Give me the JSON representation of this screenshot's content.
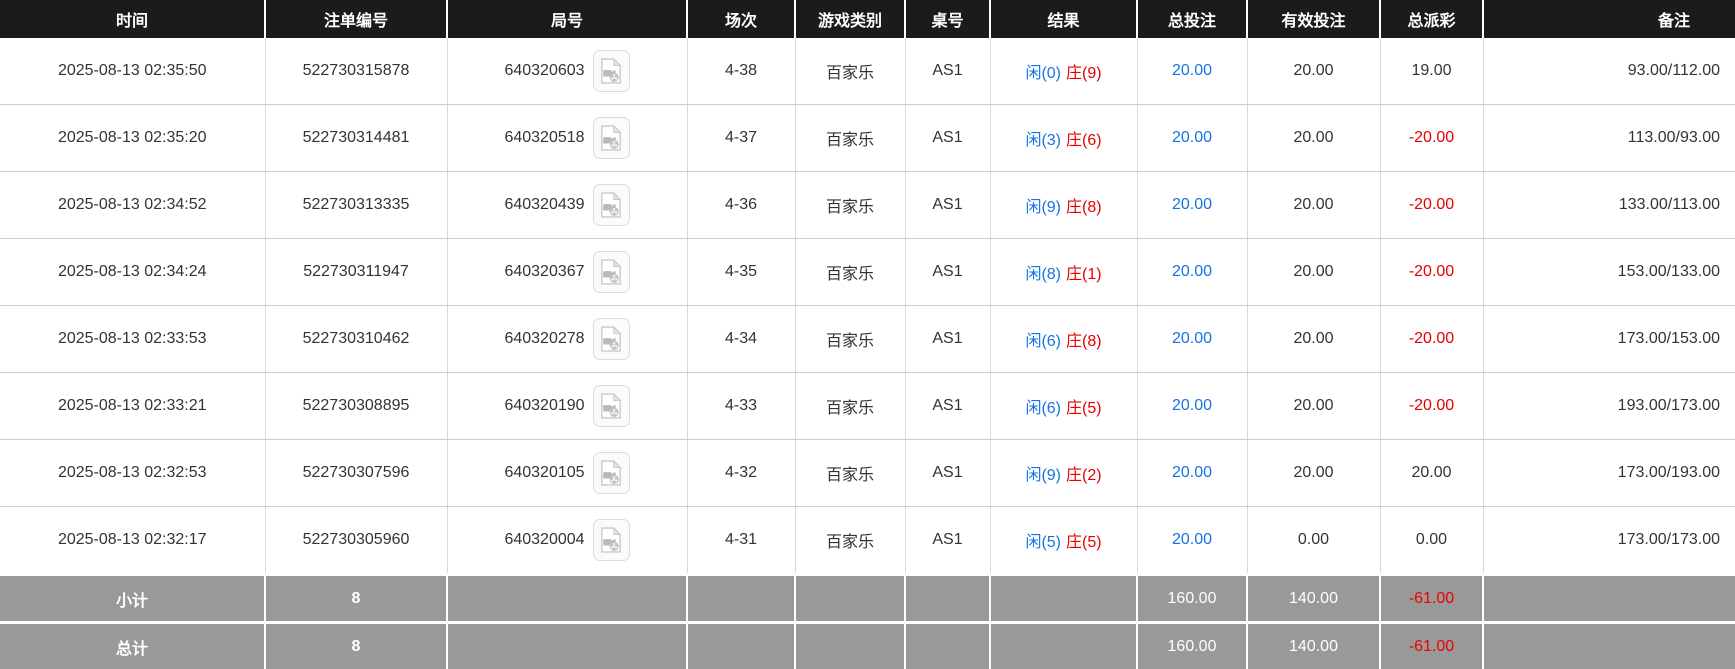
{
  "table": {
    "columns": [
      {
        "key": "time",
        "label": "时间"
      },
      {
        "key": "bet_no",
        "label": "注单编号"
      },
      {
        "key": "game_no",
        "label": "局号"
      },
      {
        "key": "session",
        "label": "场次"
      },
      {
        "key": "game_type",
        "label": "游戏类别"
      },
      {
        "key": "table_no",
        "label": "桌号"
      },
      {
        "key": "result",
        "label": "结果"
      },
      {
        "key": "total_bet",
        "label": "总投注"
      },
      {
        "key": "valid_bet",
        "label": "有效投注"
      },
      {
        "key": "payout",
        "label": "总派彩"
      },
      {
        "key": "remark",
        "label": "备注"
      }
    ],
    "rows": [
      {
        "time": "2025-08-13 02:35:50",
        "bet_no": "522730315878",
        "game_no": "640320603",
        "session": "4-38",
        "game_type": "百家乐",
        "table_no": "AS1",
        "result_player": "闲(0)",
        "result_banker": "庄(9)",
        "total_bet": "20.00",
        "valid_bet": "20.00",
        "payout": "19.00",
        "remark": "93.00/112.00"
      },
      {
        "time": "2025-08-13 02:35:20",
        "bet_no": "522730314481",
        "game_no": "640320518",
        "session": "4-37",
        "game_type": "百家乐",
        "table_no": "AS1",
        "result_player": "闲(3)",
        "result_banker": "庄(6)",
        "total_bet": "20.00",
        "valid_bet": "20.00",
        "payout": "-20.00",
        "remark": "113.00/93.00"
      },
      {
        "time": "2025-08-13 02:34:52",
        "bet_no": "522730313335",
        "game_no": "640320439",
        "session": "4-36",
        "game_type": "百家乐",
        "table_no": "AS1",
        "result_player": "闲(9)",
        "result_banker": "庄(8)",
        "total_bet": "20.00",
        "valid_bet": "20.00",
        "payout": "-20.00",
        "remark": "133.00/113.00"
      },
      {
        "time": "2025-08-13 02:34:24",
        "bet_no": "522730311947",
        "game_no": "640320367",
        "session": "4-35",
        "game_type": "百家乐",
        "table_no": "AS1",
        "result_player": "闲(8)",
        "result_banker": "庄(1)",
        "total_bet": "20.00",
        "valid_bet": "20.00",
        "payout": "-20.00",
        "remark": "153.00/133.00"
      },
      {
        "time": "2025-08-13 02:33:53",
        "bet_no": "522730310462",
        "game_no": "640320278",
        "session": "4-34",
        "game_type": "百家乐",
        "table_no": "AS1",
        "result_player": "闲(6)",
        "result_banker": "庄(8)",
        "total_bet": "20.00",
        "valid_bet": "20.00",
        "payout": "-20.00",
        "remark": "173.00/153.00"
      },
      {
        "time": "2025-08-13 02:33:21",
        "bet_no": "522730308895",
        "game_no": "640320190",
        "session": "4-33",
        "game_type": "百家乐",
        "table_no": "AS1",
        "result_player": "闲(6)",
        "result_banker": "庄(5)",
        "total_bet": "20.00",
        "valid_bet": "20.00",
        "payout": "-20.00",
        "remark": "193.00/173.00"
      },
      {
        "time": "2025-08-13 02:32:53",
        "bet_no": "522730307596",
        "game_no": "640320105",
        "session": "4-32",
        "game_type": "百家乐",
        "table_no": "AS1",
        "result_player": "闲(9)",
        "result_banker": "庄(2)",
        "total_bet": "20.00",
        "valid_bet": "20.00",
        "payout": "20.00",
        "remark": "173.00/193.00"
      },
      {
        "time": "2025-08-13 02:32:17",
        "bet_no": "522730305960",
        "game_no": "640320004",
        "session": "4-31",
        "game_type": "百家乐",
        "table_no": "AS1",
        "result_player": "闲(5)",
        "result_banker": "庄(5)",
        "total_bet": "20.00",
        "valid_bet": "0.00",
        "payout": "0.00",
        "remark": "173.00/173.00"
      }
    ],
    "footer": {
      "subtotal": {
        "label": "小计",
        "count": "8",
        "total_bet": "160.00",
        "valid_bet": "140.00",
        "payout": "-61.00"
      },
      "total": {
        "label": "总计",
        "count": "8",
        "total_bet": "160.00",
        "valid_bet": "140.00",
        "payout": "-61.00"
      }
    }
  },
  "icons": {
    "video_replay": "video-file-icon"
  },
  "colors": {
    "header_bg": "#1b1b1b",
    "link_blue": "#1673e6",
    "player_blue": "#1673e6",
    "banker_red": "#e60000",
    "loss_red": "#e60000",
    "summary_bg": "#999999",
    "summary_loss_red": "#ee0000"
  }
}
